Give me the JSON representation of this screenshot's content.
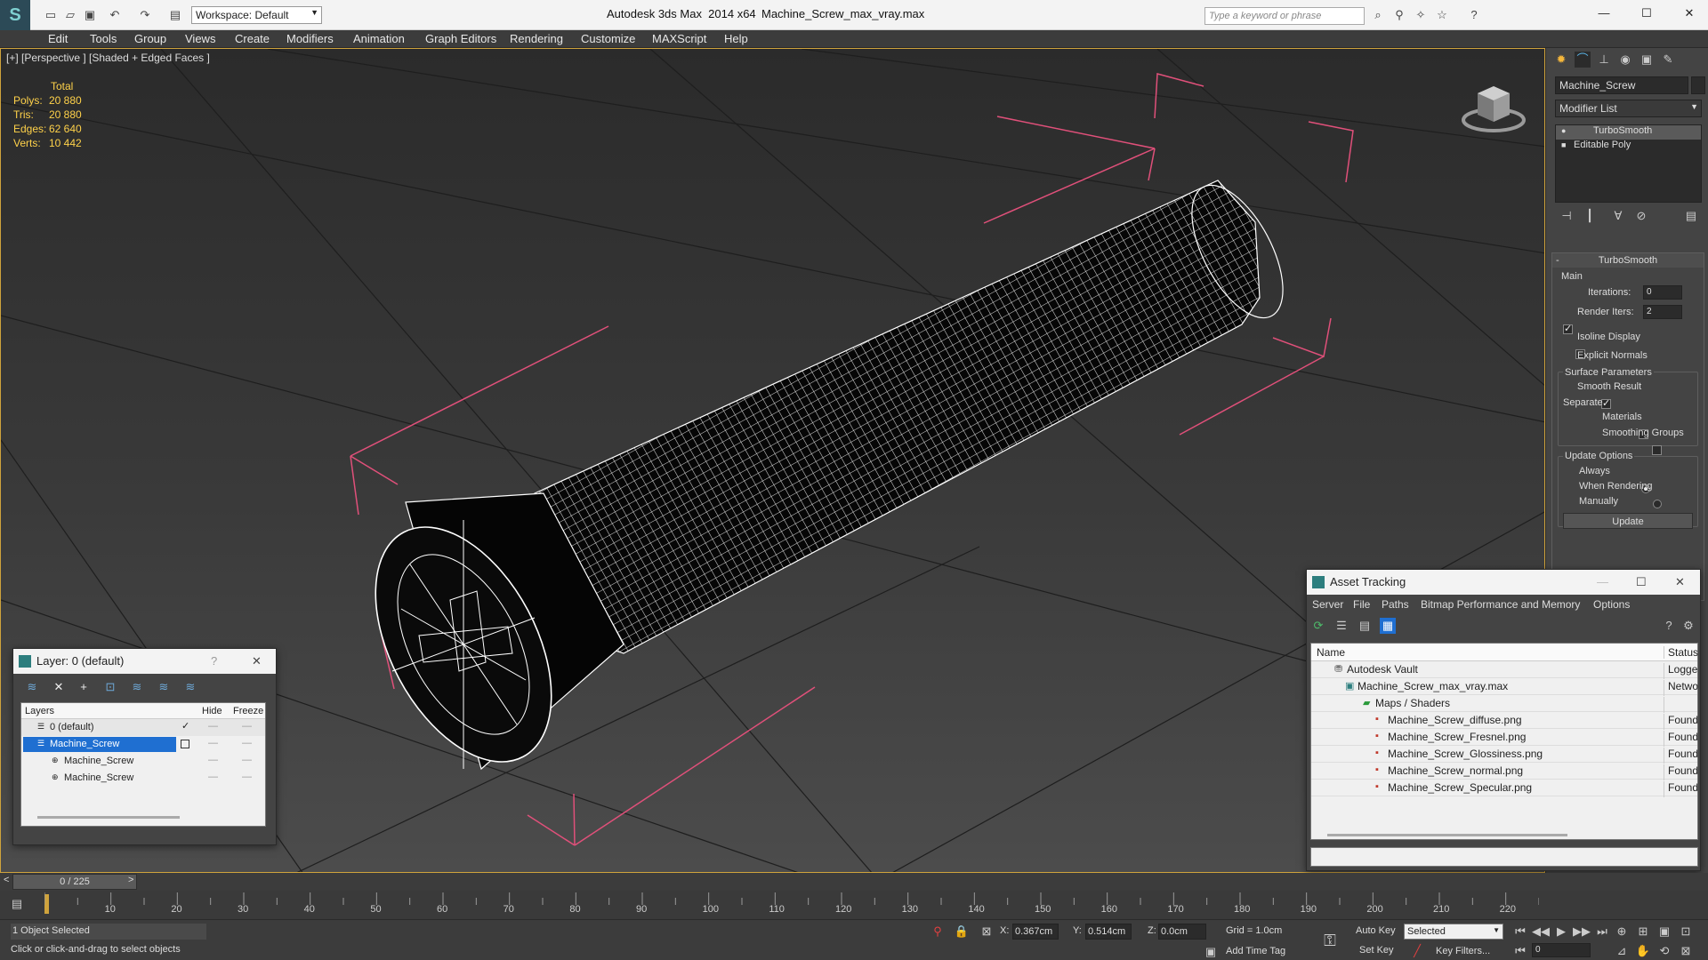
{
  "titlebar": {
    "app_title": "Autodesk 3ds Max  2014 x64",
    "file_name": "Machine_Screw_max_vray.max",
    "workspace": "Workspace: Default",
    "search_placeholder": "Type a keyword or phrase"
  },
  "menu": [
    "Edit",
    "Tools",
    "Group",
    "Views",
    "Create",
    "Modifiers",
    "Animation",
    "Graph Editors",
    "Rendering",
    "Customize",
    "MAXScript",
    "Help"
  ],
  "viewport": {
    "label": "[+] [Perspective ] [Shaded + Edged Faces ]",
    "stats": {
      "total_label": "Total",
      "polys_label": "Polys:",
      "polys": "20 880",
      "tris_label": "Tris:",
      "tris": "20 880",
      "edges_label": "Edges:",
      "edges": "62 640",
      "verts_label": "Verts:",
      "verts": "10 442"
    }
  },
  "command_panel": {
    "object_name": "Machine_Screw",
    "modifier_list": "Modifier List",
    "stack": [
      "TurboSmooth",
      "Editable Poly"
    ],
    "rollout_title": "TurboSmooth",
    "main_label": "Main",
    "iterations_label": "Iterations:",
    "iterations": "0",
    "render_iters_label": "Render Iters:",
    "render_iters": "2",
    "render_iters_checked": true,
    "isoline": "Isoline Display",
    "explicit_normals": "Explicit Normals",
    "surface_params": "Surface Parameters",
    "smooth_result": "Smooth Result",
    "separate": "Separate",
    "materials": "Materials",
    "smoothing_groups": "Smoothing Groups",
    "update_options": "Update Options",
    "always": "Always",
    "when_rendering": "When Rendering",
    "manually": "Manually",
    "update_button": "Update"
  },
  "layer_window": {
    "title": "Layer: 0 (default)",
    "help": "?",
    "columns": {
      "layers": "Layers",
      "hide": "Hide",
      "freeze": "Freeze"
    },
    "rows": [
      {
        "name": "0 (default)",
        "indent": 0
      },
      {
        "name": "Machine_Screw",
        "indent": 0
      },
      {
        "name": "Machine_Screw",
        "indent": 1
      },
      {
        "name": "Machine_Screw",
        "indent": 1
      }
    ]
  },
  "asset_window": {
    "title": "Asset Tracking",
    "menu": [
      "Server",
      "File",
      "Paths",
      "Bitmap Performance and Memory",
      "Options"
    ],
    "columns": {
      "name": "Name",
      "status": "Status"
    },
    "rows": [
      {
        "name": "Autodesk Vault",
        "status": "Logge",
        "icon": "vault-icon"
      },
      {
        "name": "Machine_Screw_max_vray.max",
        "status": "Netwo",
        "icon": "max-file-icon"
      },
      {
        "name": "Maps / Shaders",
        "status": "",
        "icon": "maps-icon"
      },
      {
        "name": "Machine_Screw_diffuse.png",
        "status": "Found",
        "icon": "png-icon"
      },
      {
        "name": "Machine_Screw_Fresnel.png",
        "status": "Found",
        "icon": "png-icon"
      },
      {
        "name": "Machine_Screw_Glossiness.png",
        "status": "Found",
        "icon": "png-icon"
      },
      {
        "name": "Machine_Screw_normal.png",
        "status": "Found",
        "icon": "png-icon"
      },
      {
        "name": "Machine_Screw_Specular.png",
        "status": "Found",
        "icon": "png-icon"
      }
    ]
  },
  "timeline": {
    "frame": "0 / 225",
    "ticks": [
      "10",
      "20",
      "30",
      "40",
      "50",
      "60",
      "70",
      "80",
      "90",
      "100",
      "110",
      "120",
      "130",
      "140",
      "150",
      "160",
      "170",
      "180",
      "190",
      "200",
      "210",
      "220"
    ]
  },
  "status": {
    "selected": "1 Object Selected",
    "prompt": "Click or click-and-drag to select objects",
    "x_label": "X:",
    "x": "0.367cm",
    "y_label": "Y:",
    "y": "0.514cm",
    "z_label": "Z:",
    "z": "0.0cm",
    "grid": "Grid = 1.0cm",
    "add_time_tag": "Add Time Tag",
    "auto_key": "Auto Key",
    "set_key": "Set Key",
    "selected_dropdown": "Selected",
    "key_filters": "Key Filters...",
    "frame_field": "0"
  },
  "colors": {
    "accent": "#cfa33c",
    "selection": "#1f6fd1",
    "stat_yellow": "#ffd24a",
    "bbox_pink": "#e0507a"
  }
}
